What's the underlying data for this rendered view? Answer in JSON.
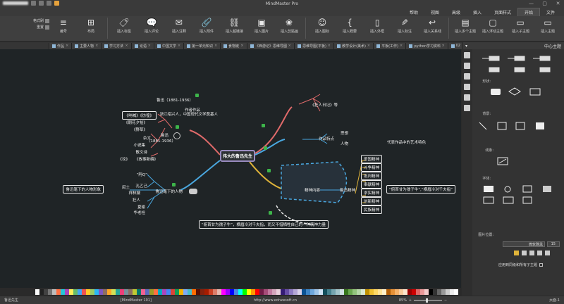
{
  "app": {
    "title": "MindMaster Pro"
  },
  "menu": [
    "文件",
    "开始",
    "页面样式",
    "插入",
    "高级",
    "视图",
    "帮助"
  ],
  "menu_active": 1,
  "ribbon": {
    "buttons": [
      {
        "label": "插入主题",
        "icon": "insert-topic-icon"
      },
      {
        "label": "插入子主题",
        "icon": "insert-subtopic-icon"
      },
      {
        "label": "插入浮动主题",
        "icon": "floating-topic-icon"
      },
      {
        "label": "插入多个主题",
        "icon": "multi-topic-icon"
      },
      {
        "label": "插入关系线",
        "icon": "relationship-icon"
      },
      {
        "label": "插入标注",
        "icon": "callout-icon"
      },
      {
        "label": "插入外框",
        "icon": "boundary-icon"
      },
      {
        "label": "插入概要",
        "icon": "summary-icon"
      },
      {
        "label": "插入图标",
        "icon": "icon-icon"
      },
      {
        "label": "插入剪贴画",
        "icon": "clipart-icon"
      },
      {
        "label": "插入图片",
        "icon": "image-icon"
      },
      {
        "label": "插入超链接",
        "icon": "hyperlink-icon"
      },
      {
        "label": "插入附件",
        "icon": "attachment-icon"
      },
      {
        "label": "插入注释",
        "icon": "note-icon"
      },
      {
        "label": "插入评论",
        "icon": "comment-icon"
      },
      {
        "label": "插入标签",
        "icon": "tag-icon"
      },
      {
        "label": "布局",
        "icon": "layout-icon"
      },
      {
        "label": "编号",
        "icon": "numbering-icon"
      }
    ],
    "small": [
      "格式刷",
      "重置"
    ]
  },
  "tabs": [
    {
      "label": "中心主题",
      "active": true
    },
    {
      "label": "鲁迅论五十七",
      "active": false
    },
    {
      "label": "阅读计划",
      "active": false
    },
    {
      "label": "02",
      "active": false
    },
    {
      "label": "python学习资料",
      "active": false
    },
    {
      "label": "平板(工作)",
      "active": false
    },
    {
      "label": "教学设计(美术)",
      "active": false
    },
    {
      "label": "思维导图(平板)",
      "active": false
    },
    {
      "label": "《西游记》思维导图",
      "active": false
    },
    {
      "label": "食物链",
      "active": false
    },
    {
      "label": "第一单元知识",
      "active": false
    },
    {
      "label": "中国文学",
      "active": false
    },
    {
      "label": "论语",
      "active": false
    },
    {
      "label": "学习方法",
      "active": false
    },
    {
      "label": "主要人物",
      "active": false
    },
    {
      "label": "作品",
      "active": false
    }
  ],
  "panel": {
    "title": "中心主题",
    "sections": [
      "形状:",
      "背景:",
      "线条:",
      "字体:",
      "图片位置:",
      "标签:"
    ],
    "font_size": "15",
    "font_name": "微软雅黑",
    "checkbox_label": "应用到同级和所有子主题"
  },
  "mindmap": {
    "center": "伟大的鲁迅先生",
    "branches": {
      "b1": {
        "label": "作者作品",
        "items": [
          "鲁迅（1881-1936）",
          "浙江绍兴人，中国现代文学奠基人",
          "《狂人日记》等"
        ]
      },
      "b2": {
        "label": "作品特点",
        "items": [
          "思想",
          "人物",
          "艺术",
          "代表作品中的艺术特色"
        ]
      },
      "b3": {
        "label": "精神内容",
        "sub": "鲁迅精神",
        "items": [
          "爱国精神",
          "斗争精神",
          "批判精神",
          "奉献精神",
          "求实精神",
          "创新精神",
          "民族精神"
        ],
        "callout": "“俯首甘为孺子牛”,“横眉冷对千夫指”"
      },
      "b4": {
        "label": "鲁迅",
        "sub": "（1881-1936）",
        "items": [
          "《呐喊》《彷徨》",
          "《朝花夕拾》",
          "《野草》",
          "小说集",
          "杂文",
          "散文诗",
          "《故事新编》",
          "《坟》"
        ]
      },
      "b5": {
        "label": "鲁迅笔下的人物",
        "items": [
          "“阿Q”",
          "孔乙己",
          "祥林嫂",
          "闰土",
          "狂人",
          "夏瑜",
          "华老栓"
        ],
        "callout": "鲁迅笔下的人物形象"
      },
      "b6": {
        "label": "“俯首甘为孺子牛”，横眉冷对千夫指，而又不惜牺牲自己的一种精神力量"
      }
    }
  },
  "status": {
    "page": "页面-1",
    "zoom": "85%",
    "website": "http://www.edrawsoft.cn",
    "topic": "[MindMaster 101]",
    "date": "鲁迅先生"
  },
  "colors": {
    "canvas": "#1f2426",
    "accent": "#5aa0e6",
    "center_border": "#9a8cc0",
    "branch_red": "#e06a6a",
    "branch_blue": "#4aa8e0",
    "branch_yellow": "#e0b43a",
    "branch_teal": "#3ab0c0"
  }
}
